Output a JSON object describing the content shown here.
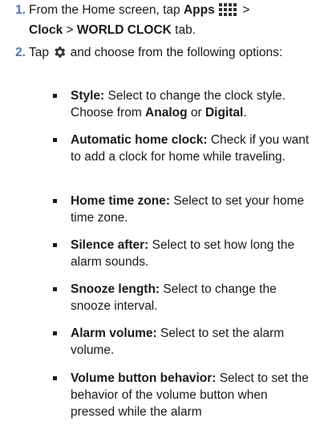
{
  "steps": [
    {
      "number": "1.",
      "pre": "From the Home screen, tap ",
      "apps": "Apps",
      "sep1": " > ",
      "clock": "Clock",
      "sep2": " > ",
      "world_clock": "WORLD CLOCK",
      "post": " tab.",
      "icon": "apps-grid-icon"
    },
    {
      "number": "2.",
      "pre": "Tap ",
      "post": " and choose from the following options:",
      "icon": "gear-icon"
    }
  ],
  "options": [
    {
      "term": "Style:",
      "text": " Select to change the clock style. Choose from ",
      "b1": "Analog",
      "mid": " or ",
      "b2": "Digital",
      "end": "."
    },
    {
      "term": "Automatic home clock:",
      "text": " Check if you want to add a clock for home while traveling."
    },
    {
      "term": "Home time zone:",
      "text": " Select to set your home time zone."
    },
    {
      "term": "Silence after:",
      "text": " Select to set how long the alarm sounds."
    },
    {
      "term": "Snooze length:",
      "text": " Select to change the snooze interval."
    },
    {
      "term": "Alarm volume:",
      "text": " Select to set the alarm volume."
    },
    {
      "term": "Volume button behavior:",
      "text": " Select to set the behavior of the volume button when pressed while the alarm"
    }
  ],
  "colors": {
    "step_number": "#4a7ab8",
    "text": "#1a1a1a"
  }
}
